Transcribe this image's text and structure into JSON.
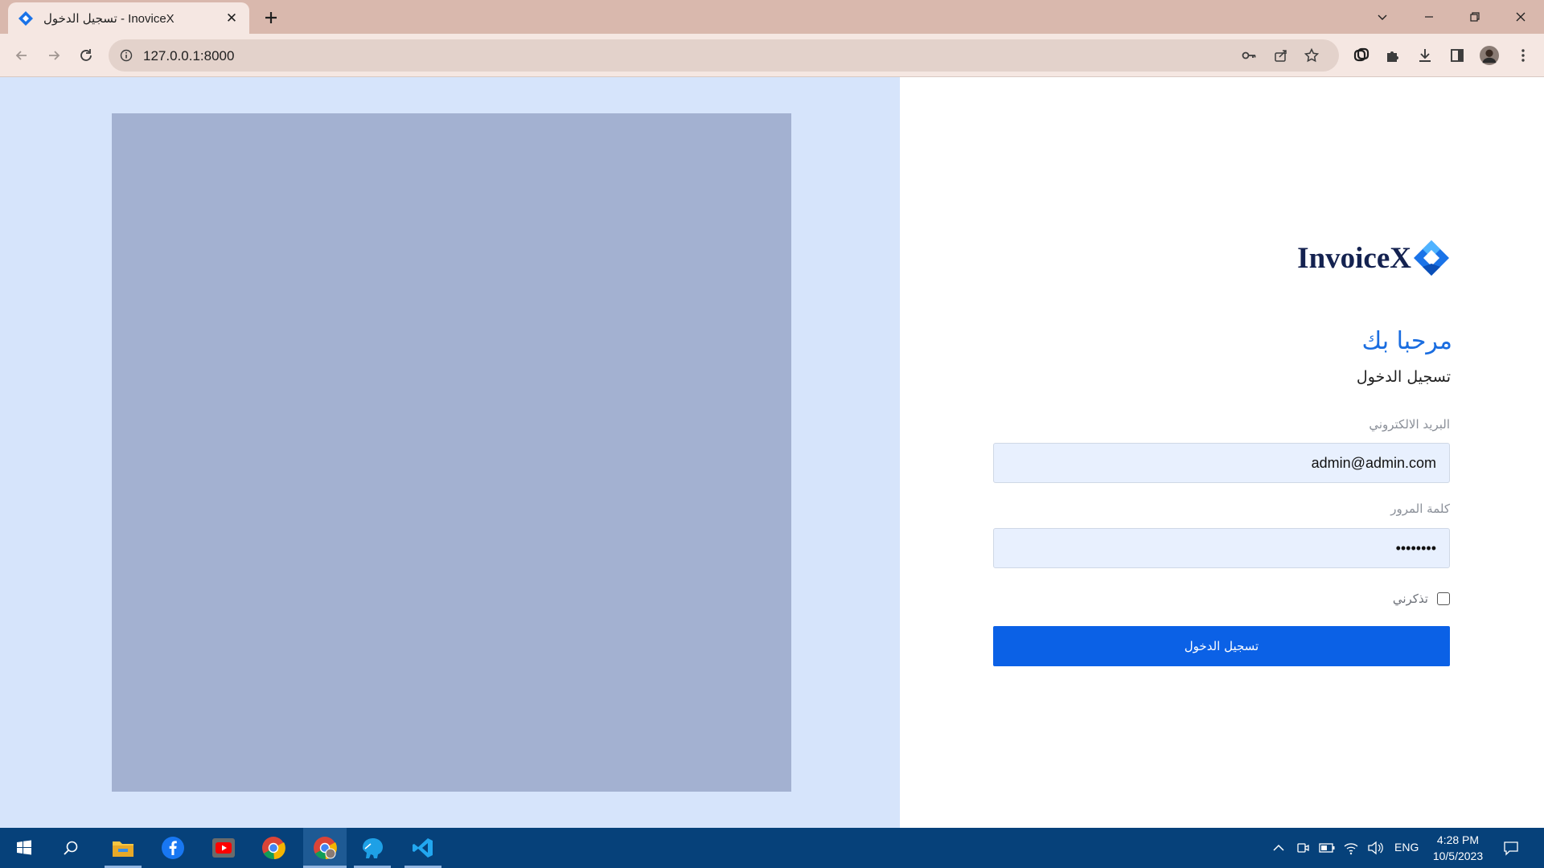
{
  "browser": {
    "tab_title": "تسجيل الدخول - InoviceX",
    "url": "127.0.0.1:8000"
  },
  "login": {
    "logo_text": "InvoiceX",
    "welcome": "مرحبا بك",
    "subtitle": "تسجيل الدخول",
    "email_label": "البريد الالكتروني",
    "email_value": "admin@admin.com",
    "password_label": "كلمة المرور",
    "password_value": "12345678",
    "remember_label": "تذكرني",
    "remember_checked": false,
    "submit_label": "تسجيل الدخول"
  },
  "taskbar": {
    "language": "ENG",
    "time": "4:28 PM",
    "date": "10/5/2023"
  },
  "colors": {
    "accent": "#0b61e6",
    "welcome": "#1a6de0",
    "left_pane": "#d6e4fb",
    "image_placeholder": "#a3b1d1",
    "taskbar": "#06417a",
    "tab_strip": "#d9b8ad"
  }
}
